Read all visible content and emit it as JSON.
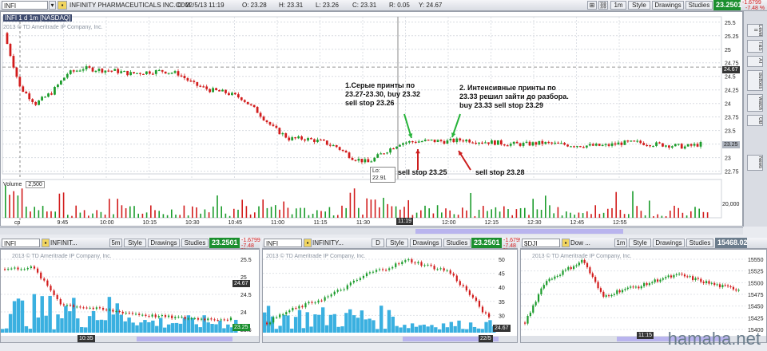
{
  "main": {
    "symbol": "INFI",
    "company": "INFINITY PHARMACEUTICALS INC.COM",
    "ohlc": {
      "d": "D: 22/5/13 11:19",
      "o": "O: 23.28",
      "h": "H: 23.31",
      "l": "L: 23.26",
      "c": "C: 23.31",
      "r": "R: 0.05",
      "y": "Y: 24.67"
    },
    "chart_label": "INFI 1 d 1m [NASDAQ]",
    "interval": "1m",
    "style_label": "Style",
    "drawings_label": "Drawings",
    "studies_label": "Studies",
    "price": "23.2501",
    "change1": "-1.6799",
    "change2": "-7.48 %",
    "copyright": "2013 © TD Ameritrade IP Company, Inc.",
    "volume_label": "Volume",
    "volume_value": "2,500",
    "volume_axis": "20,000",
    "price_ticks": [
      "25.5",
      "25.25",
      "25",
      "24.75",
      "24.5",
      "24.25",
      "24",
      "23.75",
      "23.5",
      "23.25",
      "23",
      "22.75"
    ],
    "prev_close_tag": "24.67",
    "last_tag": "23.25",
    "low_label": "Lo: 22.91",
    "time_ticks": [
      "cp",
      "9:45",
      "10:00",
      "10:15",
      "10:30",
      "10:45",
      "11:00",
      "11:15",
      "11:30",
      "11:45",
      "12:00",
      "12:15",
      "12:30",
      "12:45",
      "12:55"
    ],
    "cursor_time": "11:19",
    "annotation1": [
      "1.Серые принты по",
      "23.27-23.30,  buy 23.32",
      "sell stop 23.26"
    ],
    "annotation2": [
      "2. Интенсивные принты по",
      "23.33 решил зайти до разбора.",
      "buy 23.33 sell stop 23.29"
    ],
    "sell_label1": "sell stop 23.25",
    "sell_label2": "sell stop 23.28",
    "side_tabs": [
      "Level II",
      "T&S",
      "AT",
      "Buttons",
      "Watch",
      "OB",
      "News"
    ]
  },
  "chart_data": [
    {
      "type": "line",
      "title": "INFI 1 d 1m [NASDAQ]",
      "x": [
        "9:30",
        "9:35",
        "9:40",
        "9:45",
        "9:50",
        "9:55",
        "10:00",
        "10:05",
        "10:10",
        "10:15",
        "10:20",
        "10:25",
        "10:30",
        "10:35",
        "10:40",
        "10:45",
        "10:50",
        "10:55",
        "11:00",
        "11:05",
        "11:10",
        "11:15",
        "11:20",
        "11:25",
        "11:30",
        "11:35",
        "11:40",
        "11:45",
        "11:50",
        "11:55",
        "12:00",
        "12:05",
        "12:10",
        "12:15",
        "12:20",
        "12:25",
        "12:30",
        "12:35",
        "12:40",
        "12:45",
        "12:50"
      ],
      "series": [
        {
          "values": [
            25.3,
            24.3,
            24.0,
            24.2,
            24.55,
            24.65,
            24.62,
            24.6,
            24.55,
            24.58,
            24.6,
            24.55,
            24.35,
            24.25,
            24.2,
            24.1,
            23.85,
            23.55,
            23.35,
            23.35,
            23.3,
            23.2,
            23.0,
            22.91,
            23.1,
            23.27,
            23.3,
            23.31,
            23.3,
            23.33,
            23.3,
            23.28,
            23.25,
            23.25,
            23.27,
            23.25,
            23.23,
            23.22,
            23.22,
            23.27,
            23.28,
            23.25,
            23.23,
            23.2,
            23.25
          ]
        }
      ],
      "ylim": [
        22.7,
        25.6
      ],
      "prev_close": 24.67,
      "low": 22.91,
      "xlabel": "",
      "ylabel": ""
    }
  ],
  "bottom_left": {
    "symbol": "INFI",
    "company": "INFINIT...",
    "interval": "5m",
    "style_label": "Style",
    "drawings_label": "Drawings",
    "studies_label": "Studies",
    "price": "23.2501",
    "change1": "-1.6799",
    "change2": "-7.48 %",
    "copyright": "2013 © TD Ameritrade IP Company, Inc.",
    "ticks": [
      "25.5",
      "25",
      "24.5",
      "24",
      "23.5"
    ],
    "prev_tag": "24.67",
    "last_tag": "23.25",
    "time_tag": "10:35"
  },
  "bottom_mid": {
    "symbol": "INFI",
    "company": "INFINITY...",
    "interval": "D",
    "style_label": "Style",
    "drawings_label": "Drawings",
    "studies_label": "Studies",
    "price": "23.2501",
    "change1": "-1.6799",
    "change2": "-7.48 %",
    "copyright": "2013 © TD Ameritrade IP Company, Inc.",
    "ticks": [
      "50",
      "45",
      "40",
      "35",
      "30",
      "25"
    ],
    "last_tag": "24.67",
    "time_tag": "22/5"
  },
  "bottom_right": {
    "symbol": "$DJI",
    "company": "Dow ...",
    "interval": "1m",
    "style_label": "Style",
    "drawings_label": "Drawings",
    "studies_label": "Studies",
    "price": "15468.02",
    "change1": "",
    "change2": "",
    "copyright": "2013 © TD Ameritrade IP Company, Inc.",
    "ticks": [
      "15550",
      "15525",
      "15500",
      "15475",
      "15450",
      "15425",
      "15400"
    ],
    "time_tag": "11:15"
  },
  "watermark": "hamaha.net",
  "colors": {
    "up": "#1c9c2c",
    "down": "#d21c1c",
    "price_green": "#1b8f2e",
    "tag_dark": "#333333",
    "volume_bar": "#3ab0e0"
  }
}
